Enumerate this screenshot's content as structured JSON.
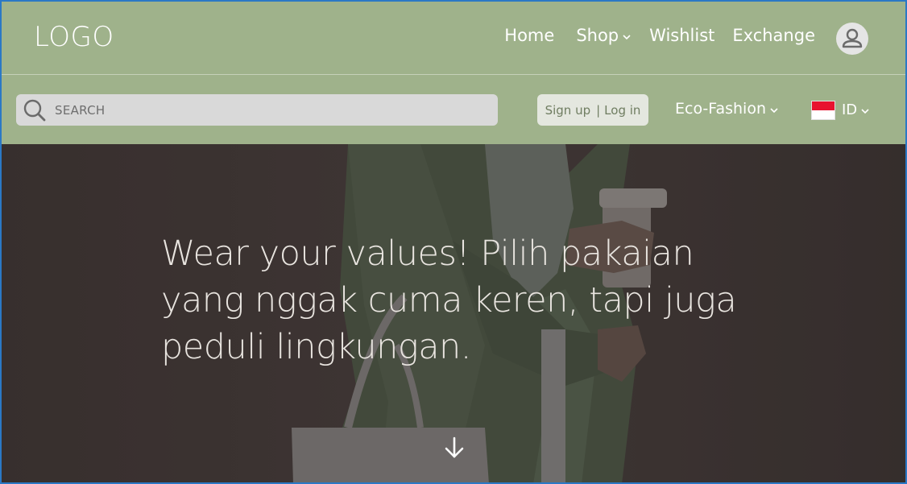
{
  "header": {
    "logo": "LOGO",
    "nav": {
      "home": "Home",
      "shop": "Shop",
      "wishlist": "Wishlist",
      "exchange": "Exchange"
    },
    "avatar_icon": "user-icon"
  },
  "subheader": {
    "search": {
      "placeholder": "SEARCH",
      "icon": "search-icon"
    },
    "auth": {
      "signup": "Sign up",
      "separator": "|",
      "login": "Log in"
    },
    "category": "Eco-Fashion",
    "language": {
      "code": "ID",
      "flag": "indonesia-flag"
    }
  },
  "hero": {
    "headline": "Wear your values! Pilih pakaian yang nggak cuma keren, tapi juga peduli lingkungan.",
    "scroll_icon": "arrow-down-icon"
  },
  "colors": {
    "header_bg": "#9fb28b",
    "search_bg": "#d9d9d9",
    "auth_bg": "#e4e7df",
    "hero_bg": "#463f3d",
    "frame_border": "#2b78c5"
  }
}
